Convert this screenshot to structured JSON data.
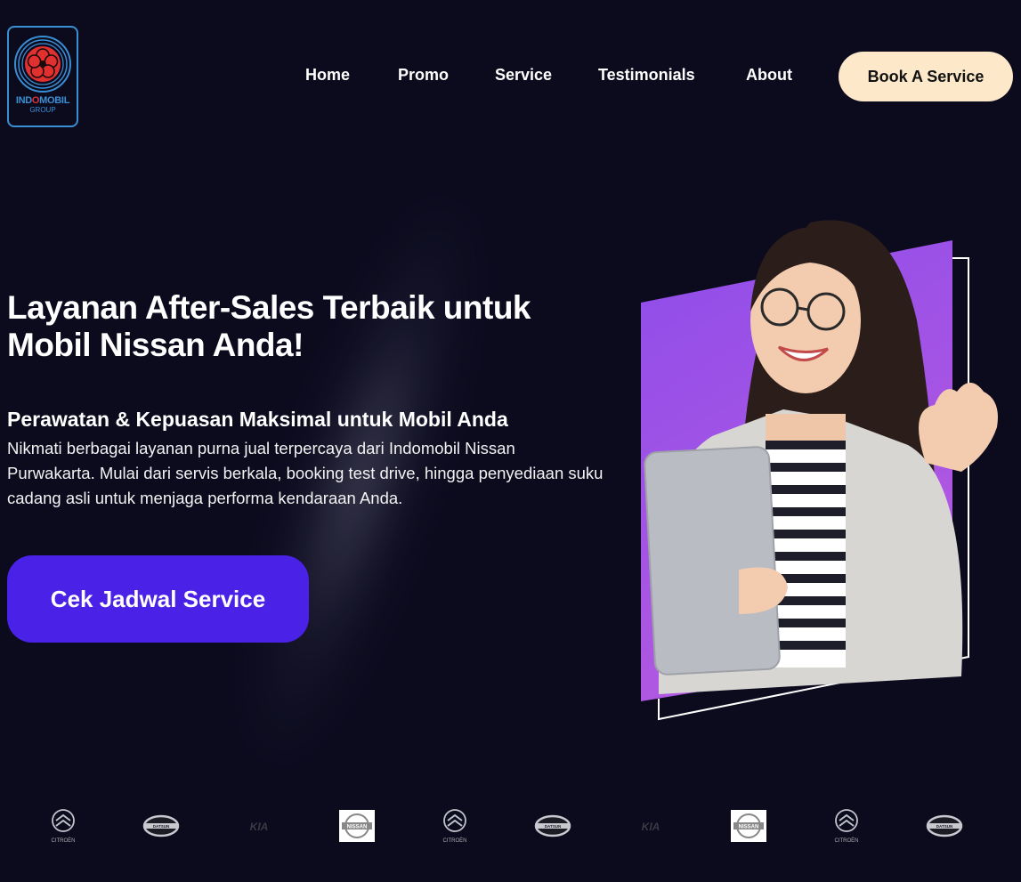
{
  "logo": {
    "name_part1": "IND",
    "name_o": "O",
    "name_part2": "MOBIL",
    "sub": "GROUP"
  },
  "nav": {
    "items": [
      {
        "label": "Home"
      },
      {
        "label": "Promo"
      },
      {
        "label": "Service"
      },
      {
        "label": "Testimonials"
      },
      {
        "label": "About"
      }
    ],
    "book_label": "Book A Service"
  },
  "hero": {
    "title_line1": "Layanan After-Sales Terbaik untuk",
    "title_line2": "Mobil Nissan Anda!",
    "subtitle": "Perawatan & Kepuasan Maksimal untuk Mobil Anda",
    "description": "Nikmati berbagai layanan purna jual terpercaya dari Indomobil Nissan Purwakarta. Mulai dari servis berkala, booking test drive, hingga penyediaan suku cadang asli untuk menjaga performa kendaraan Anda.",
    "cta_label": "Cek Jadwal Service"
  },
  "brands": [
    {
      "icon": "citroen-logo-icon",
      "label": "CITROËN"
    },
    {
      "icon": "datsun-logo-icon",
      "label": "DATSUN"
    },
    {
      "icon": "kia-logo-icon",
      "label": "KIA"
    },
    {
      "icon": "nissan-logo-icon",
      "label": "NISSAN"
    },
    {
      "icon": "citroen-logo-icon",
      "label": "CITROËN"
    },
    {
      "icon": "datsun-logo-icon",
      "label": "DATSUN"
    },
    {
      "icon": "kia-logo-icon",
      "label": "KIA"
    },
    {
      "icon": "nissan-logo-icon",
      "label": "NISSAN"
    },
    {
      "icon": "citroen-logo-icon",
      "label": "CITROËN"
    },
    {
      "icon": "datsun-logo-icon",
      "label": "DATSUN"
    }
  ],
  "colors": {
    "background": "#0c0b1e",
    "accent": "#4a21e6",
    "book_button": "#fde9c9",
    "logo_blue": "#3a8fd4",
    "logo_red": "#e03030",
    "photo_panel": "#9b4fe8"
  }
}
